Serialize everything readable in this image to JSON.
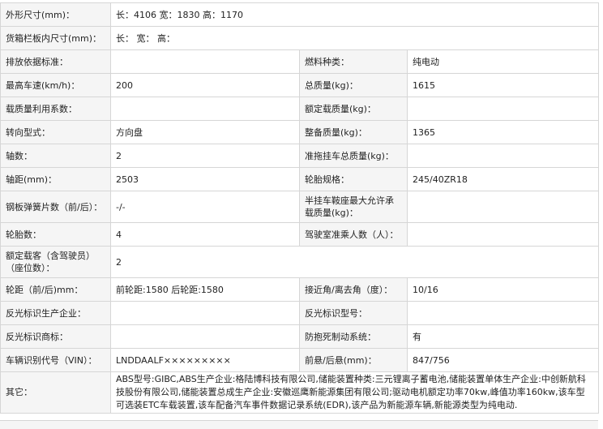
{
  "rows": [
    {
      "label": "外形尺寸(mm)：",
      "value": "长：4106 宽：1830 高：1170"
    },
    {
      "label": "货箱栏板内尺寸(mm)：",
      "value": "长： 宽： 高："
    },
    {
      "label": "排放依据标准：",
      "value": "",
      "label2": "燃料种类：",
      "value2": "纯电动"
    },
    {
      "label": "最高车速(km/h)：",
      "value": "200",
      "label2": "总质量(kg)：",
      "value2": "1615"
    },
    {
      "label": "载质量利用系数：",
      "value": "",
      "label2": "额定载质量(kg)：",
      "value2": ""
    },
    {
      "label": "转向型式：",
      "value": "方向盘",
      "label2": "整备质量(kg)：",
      "value2": "1365"
    },
    {
      "label": "轴数：",
      "value": "2",
      "label2": "准拖挂车总质量(kg)：",
      "value2": ""
    },
    {
      "label": "轴距(mm)：",
      "value": "2503",
      "label2": "轮胎规格：",
      "value2": "245/40ZR18"
    },
    {
      "label": "钢板弹簧片数（前/后）：",
      "value": "-/-",
      "label2": "半挂车鞍座最大允许承载质量(kg)：",
      "value2": ""
    },
    {
      "label": "轮胎数：",
      "value": "4",
      "label2": "驾驶室准乘人数（人）：",
      "value2": ""
    },
    {
      "label": "额定载客（含驾驶员）（座位数）：",
      "value": "2"
    },
    {
      "label": "轮距（前/后)mm：",
      "value": "前轮距:1580 后轮距:1580",
      "label2": "接近角/离去角（度）：",
      "value2": "10/16"
    },
    {
      "label": "反光标识生产企业：",
      "value": "",
      "label2": "反光标识型号：",
      "value2": ""
    },
    {
      "label": "反光标识商标：",
      "value": "",
      "label2": "防抱死制动系统：",
      "value2": "有"
    },
    {
      "label": "车辆识别代号（VIN）：",
      "value": "LNDDAALF×××××××××",
      "label2": "前悬/后悬(mm)：",
      "value2": "847/756"
    },
    {
      "label": "其它：",
      "value": "ABS型号:GIBC,ABS生产企业:格陆博科技有限公司,储能装置种类:三元锂离子蓄电池,储能装置单体生产企业:中创新航科技股份有限公司,储能装置总成生产企业:安徽巡鹰新能源集团有限公司;驱动电机额定功率70kw,峰值功率160kw,该车型可选装ETC车载装置,该车配备汽车事件数据记录系统(EDR),该产品为新能源车辆,新能源类型为纯电动."
    }
  ]
}
